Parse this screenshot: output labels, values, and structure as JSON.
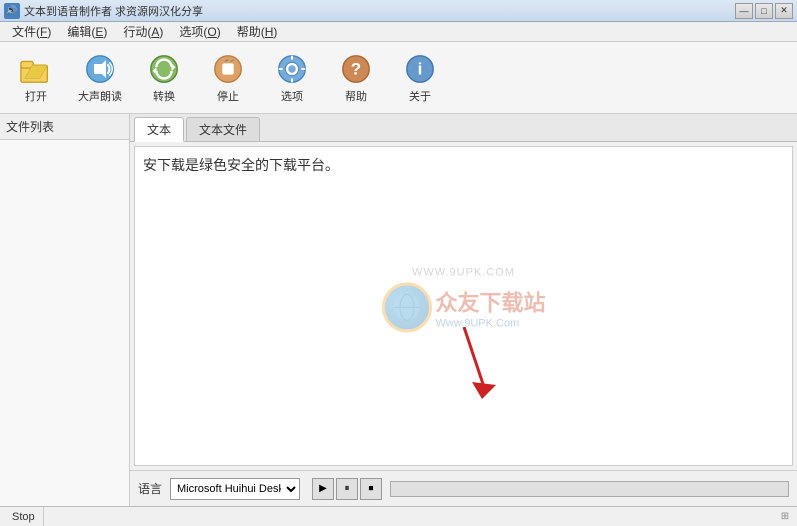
{
  "titleBar": {
    "title": "文本到语音制作者 求资源网汉化分享",
    "icon": "🔊",
    "controls": [
      "—",
      "□",
      "✕"
    ]
  },
  "menuBar": {
    "items": [
      {
        "label": "文件(F)",
        "key": "F"
      },
      {
        "label": "编辑(E)",
        "key": "E"
      },
      {
        "label": "行动(A)",
        "key": "A"
      },
      {
        "label": "选项(O)",
        "key": "O"
      },
      {
        "label": "帮助(H)",
        "key": "H"
      }
    ]
  },
  "toolbar": {
    "buttons": [
      {
        "id": "open",
        "label": "打开",
        "icon": "folder"
      },
      {
        "id": "read",
        "label": "大声朗读",
        "icon": "speaker"
      },
      {
        "id": "convert",
        "label": "转换",
        "icon": "convert"
      },
      {
        "id": "stop",
        "label": "停止",
        "icon": "stop"
      },
      {
        "id": "options",
        "label": "选项",
        "icon": "options"
      },
      {
        "id": "help",
        "label": "帮助",
        "icon": "help"
      },
      {
        "id": "about",
        "label": "关于",
        "icon": "info"
      }
    ]
  },
  "fileList": {
    "header": "文件列表"
  },
  "tabs": [
    {
      "label": "文本",
      "active": true
    },
    {
      "label": "文本文件",
      "active": false
    }
  ],
  "editor": {
    "content": "安下载是绿色安全的下载平台。",
    "watermark": {
      "url_top": "WWW.9UPK.COM",
      "cn_name": "众友下载站",
      "url_bottom": "Www.9UPK.Com"
    }
  },
  "bottomBar": {
    "languageLabel": "语言",
    "languageValue": "Microsoft Huihui Deskt",
    "playBtn": "▶",
    "pauseBtn": "⏸",
    "stopBtn": "⏹"
  },
  "statusBar": {
    "status": "Stop",
    "gripperSymbol": "⊞"
  }
}
